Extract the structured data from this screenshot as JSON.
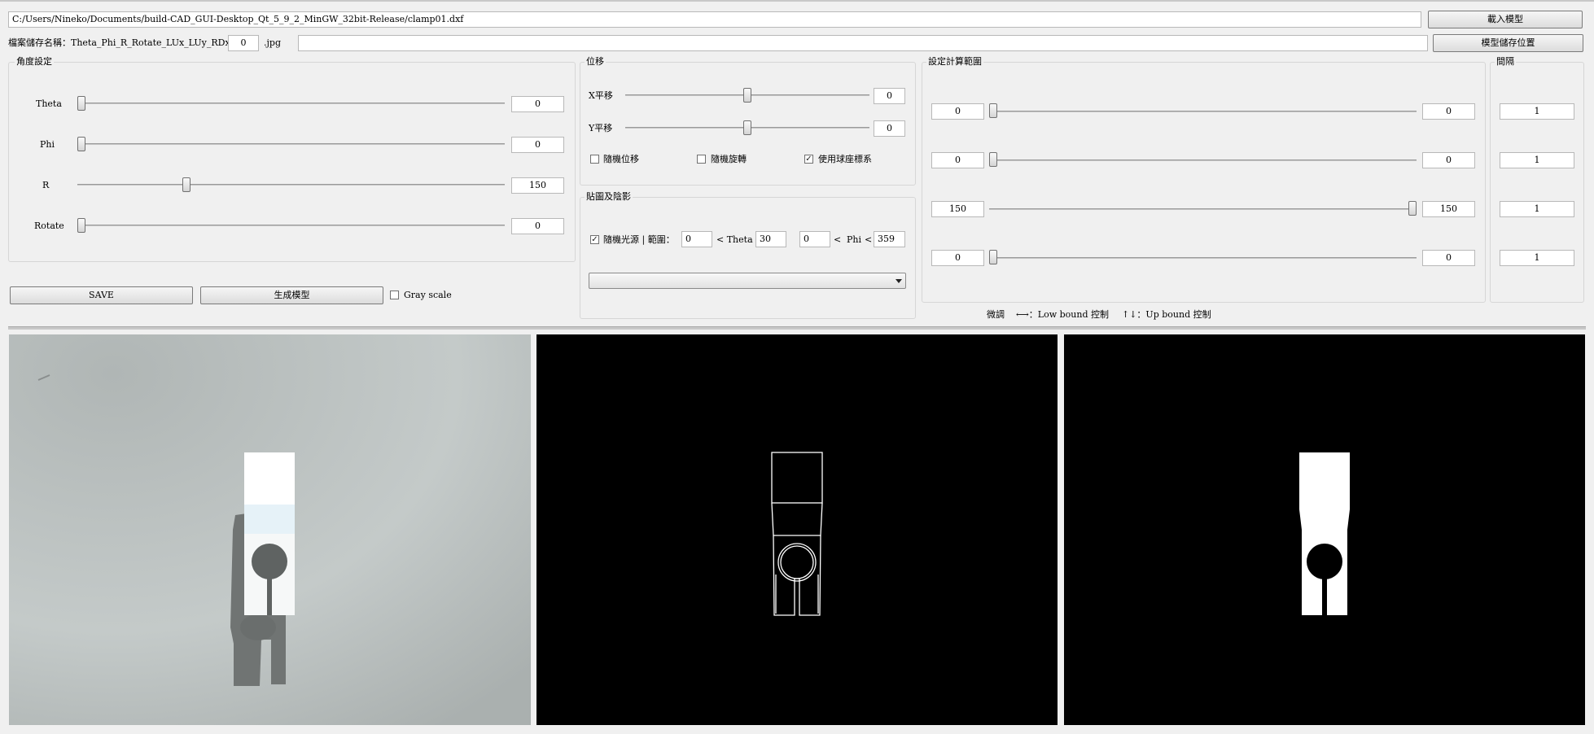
{
  "file": {
    "model_path": "C:/Users/Nineko/Documents/build-CAD_GUI-Desktop_Qt_5_9_2_MinGW_32bit-Release/clamp01.dxf",
    "load_button": "載入模型",
    "filename_label": "檔案儲存名稱：Theta_Phi_R_Rotate_LUx_LUy_RDx_RDy_",
    "filename_index": "0",
    "filename_ext": ".jpg",
    "save_path": "",
    "save_location_button": "模型儲存位置"
  },
  "angle": {
    "title": "角度設定",
    "rows": [
      {
        "label": "Theta",
        "value": "0",
        "level": 0.0
      },
      {
        "label": "Phi",
        "value": "0",
        "level": 0.0
      },
      {
        "label": "R",
        "value": "150",
        "level": 0.25
      },
      {
        "label": "Rotate",
        "value": "0",
        "level": 0.0
      }
    ]
  },
  "actions": {
    "save": "SAVE",
    "generate": "生成模型",
    "grayscale_label": "Gray scale",
    "grayscale_checked": false
  },
  "translate": {
    "title": "位移",
    "x_label": "X平移",
    "x_value": "0",
    "x_level": 0.5,
    "y_label": "Y平移",
    "y_value": "0",
    "y_level": 0.5,
    "random_translate": "隨機位移",
    "random_translate_checked": false,
    "random_rotate": "隨機旋轉",
    "random_rotate_checked": false,
    "spherical": "使用球座標系",
    "spherical_checked": true
  },
  "texture": {
    "title": "貼圖及陰影",
    "random_light": "隨機光源 | 範圍：",
    "random_light_checked": true,
    "theta_min": "0",
    "theta_label": "< Theta <",
    "theta_max": "30",
    "phi_min": "0",
    "phi_sep": "<",
    "phi_label": "Phi",
    "phi_sep2": "<",
    "phi_max": "359",
    "combo_value": ""
  },
  "range": {
    "title": "設定計算範圍",
    "interval_title": "間隔",
    "rows": [
      {
        "low": "0",
        "high": "0",
        "interval": "1",
        "level": 0.0
      },
      {
        "low": "0",
        "high": "0",
        "interval": "1",
        "level": 0.0
      },
      {
        "low": "150",
        "high": "150",
        "interval": "1",
        "level": 1.0
      },
      {
        "low": "0",
        "high": "0",
        "interval": "1",
        "level": 0.0
      }
    ],
    "hint_fine": "微調",
    "hint_low": "⟷：Low bound 控制",
    "hint_up": "↑↓：Up bound 控制"
  },
  "colors": {
    "panel_bg": "#f0f0f0",
    "photo_bg": "#b8bebd",
    "edge_bg": "#000000",
    "mask_white": "#ffffff"
  }
}
